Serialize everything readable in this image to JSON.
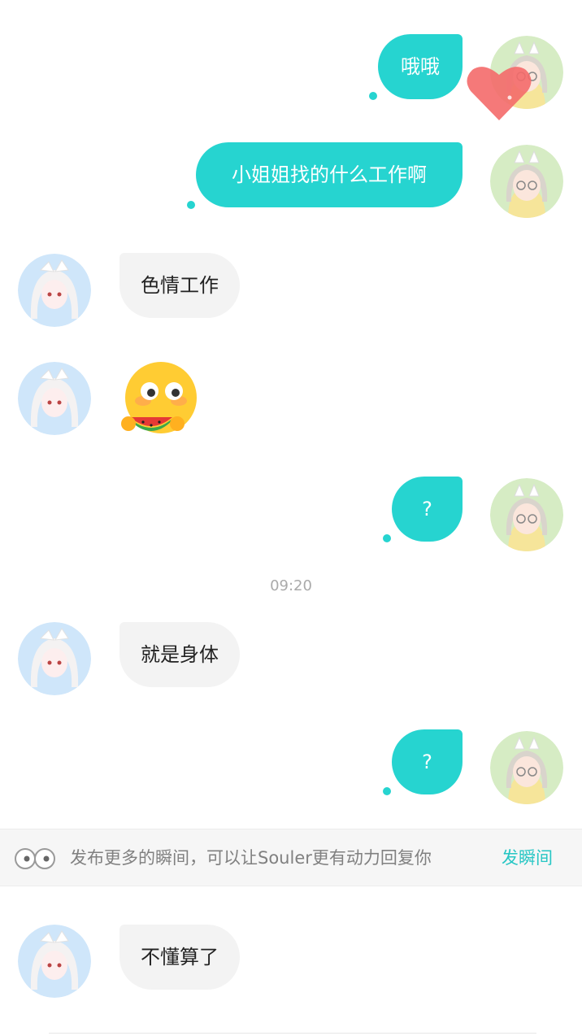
{
  "messages": [
    {
      "id": "m1",
      "side": "out",
      "text": "哦哦"
    },
    {
      "id": "m2",
      "side": "out",
      "text": "小姐姐找的什么工作啊"
    },
    {
      "id": "m3",
      "side": "in",
      "text": "色情工作"
    },
    {
      "id": "m4",
      "side": "in",
      "emoji": "flushed-watermelon-emoji"
    },
    {
      "id": "m5",
      "side": "out",
      "text": "?"
    },
    {
      "id": "m6",
      "side": "in",
      "text": "就是身体"
    },
    {
      "id": "m7",
      "side": "out",
      "text": "?"
    },
    {
      "id": "m8",
      "side": "in",
      "text": "不懂算了"
    }
  ],
  "timestamp": "09:20",
  "banner": {
    "text": "发布更多的瞬间，可以让Souler更有动力回复你",
    "action": "发瞬间",
    "icon": "eyes-icon"
  },
  "colors": {
    "outgoing_bubble": "#26d4d0",
    "incoming_bubble": "#f3f3f3",
    "accent_text": "#26c6c4",
    "heart": "#f46a6a"
  }
}
